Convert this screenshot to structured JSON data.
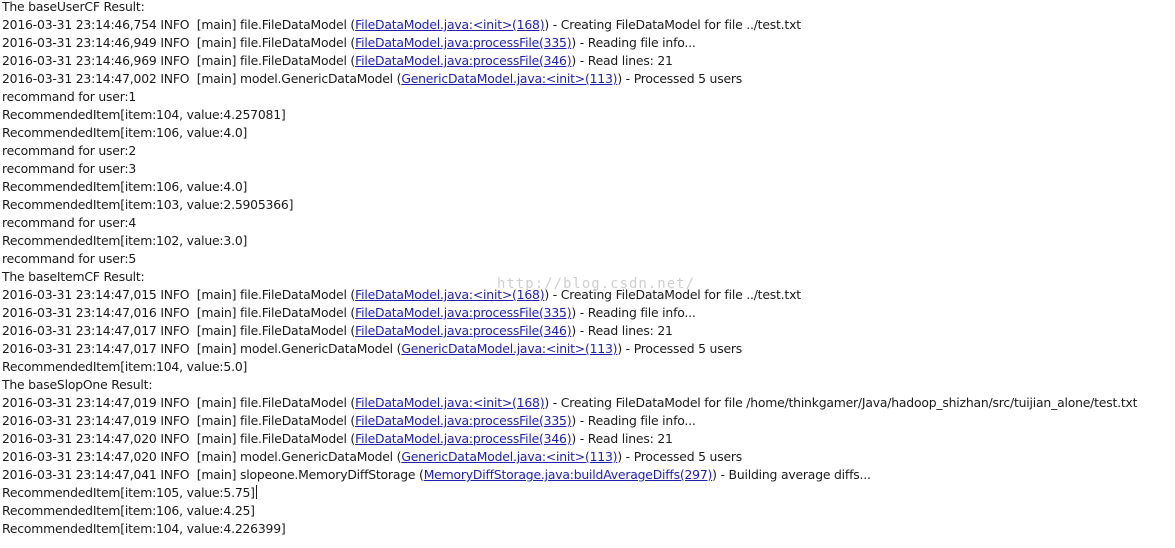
{
  "watermark": "http://blog.csdn.net/",
  "lines": [
    {
      "type": "text",
      "text": "The baseUserCF Result:"
    },
    {
      "type": "log",
      "pre": "2016-03-31 23:14:46,754 INFO  [main] file.FileDataModel (",
      "link": "FileDataModel.java:<init>(168)",
      "post": ") - Creating FileDataModel for file ../test.txt"
    },
    {
      "type": "log",
      "pre": "2016-03-31 23:14:46,949 INFO  [main] file.FileDataModel (",
      "link": "FileDataModel.java:processFile(335)",
      "post": ") - Reading file info..."
    },
    {
      "type": "log",
      "pre": "2016-03-31 23:14:46,969 INFO  [main] file.FileDataModel (",
      "link": "FileDataModel.java:processFile(346)",
      "post": ") - Read lines: 21"
    },
    {
      "type": "log",
      "pre": "2016-03-31 23:14:47,002 INFO  [main] model.GenericDataModel (",
      "link": "GenericDataModel.java:<init>(113)",
      "post": ") - Processed 5 users"
    },
    {
      "type": "text",
      "text": "recommand for user:1"
    },
    {
      "type": "text",
      "text": "RecommendedItem[item:104, value:4.257081]"
    },
    {
      "type": "text",
      "text": "RecommendedItem[item:106, value:4.0]"
    },
    {
      "type": "text",
      "text": "recommand for user:2"
    },
    {
      "type": "text",
      "text": "recommand for user:3"
    },
    {
      "type": "text",
      "text": "RecommendedItem[item:106, value:4.0]"
    },
    {
      "type": "text",
      "text": "RecommendedItem[item:103, value:2.5905366]"
    },
    {
      "type": "text",
      "text": "recommand for user:4"
    },
    {
      "type": "text",
      "text": "RecommendedItem[item:102, value:3.0]"
    },
    {
      "type": "text",
      "text": "recommand for user:5"
    },
    {
      "type": "text",
      "text": "The baseItemCF Result:"
    },
    {
      "type": "log",
      "pre": "2016-03-31 23:14:47,015 INFO  [main] file.FileDataModel (",
      "link": "FileDataModel.java:<init>(168)",
      "post": ") - Creating FileDataModel for file ../test.txt"
    },
    {
      "type": "log",
      "pre": "2016-03-31 23:14:47,016 INFO  [main] file.FileDataModel (",
      "link": "FileDataModel.java:processFile(335)",
      "post": ") - Reading file info..."
    },
    {
      "type": "log",
      "pre": "2016-03-31 23:14:47,017 INFO  [main] file.FileDataModel (",
      "link": "FileDataModel.java:processFile(346)",
      "post": ") - Read lines: 21"
    },
    {
      "type": "log",
      "pre": "2016-03-31 23:14:47,017 INFO  [main] model.GenericDataModel (",
      "link": "GenericDataModel.java:<init>(113)",
      "post": ") - Processed 5 users"
    },
    {
      "type": "text",
      "text": "RecommendedItem[item:104, value:5.0]"
    },
    {
      "type": "text",
      "text": "The baseSlopOne Result:"
    },
    {
      "type": "log",
      "pre": "2016-03-31 23:14:47,019 INFO  [main] file.FileDataModel (",
      "link": "FileDataModel.java:<init>(168)",
      "post": ") - Creating FileDataModel for file /home/thinkgamer/Java/hadoop_shizhan/src/tuijian_alone/test.txt"
    },
    {
      "type": "log",
      "pre": "2016-03-31 23:14:47,019 INFO  [main] file.FileDataModel (",
      "link": "FileDataModel.java:processFile(335)",
      "post": ") - Reading file info..."
    },
    {
      "type": "log",
      "pre": "2016-03-31 23:14:47,020 INFO  [main] file.FileDataModel (",
      "link": "FileDataModel.java:processFile(346)",
      "post": ") - Read lines: 21"
    },
    {
      "type": "log",
      "pre": "2016-03-31 23:14:47,020 INFO  [main] model.GenericDataModel (",
      "link": "GenericDataModel.java:<init>(113)",
      "post": ") - Processed 5 users"
    },
    {
      "type": "log",
      "pre": "2016-03-31 23:14:47,041 INFO  [main] slopeone.MemoryDiffStorage (",
      "link": "MemoryDiffStorage.java:buildAverageDiffs(297)",
      "post": ") - Building average diffs..."
    },
    {
      "type": "text",
      "text": "RecommendedItem[item:105, value:5.75]",
      "caret": true
    },
    {
      "type": "text",
      "text": "RecommendedItem[item:106, value:4.25]"
    },
    {
      "type": "text",
      "text": "RecommendedItem[item:104, value:4.226399]"
    }
  ]
}
